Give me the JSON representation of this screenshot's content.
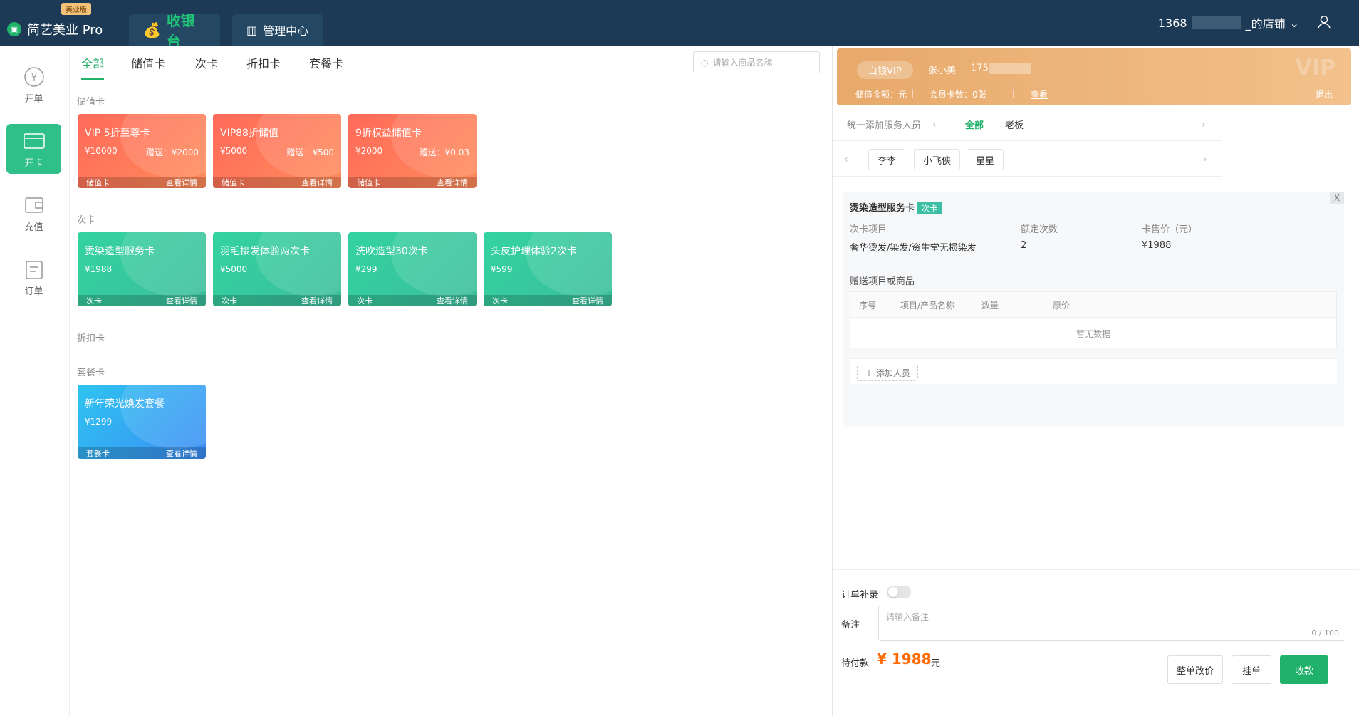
{
  "app": {
    "name": "简艺美业 Pro",
    "edition": "美业版"
  },
  "top_tabs": [
    {
      "label": "收银台"
    },
    {
      "label": "管理中心"
    }
  ],
  "store": {
    "prefix": "1368",
    "suffix": "_的店铺"
  },
  "left_nav": [
    {
      "label": "开单"
    },
    {
      "label": "开卡"
    },
    {
      "label": "充值"
    },
    {
      "label": "订单"
    }
  ],
  "product_tabs": [
    "全部",
    "储值卡",
    "次卡",
    "折扣卡",
    "套餐卡"
  ],
  "search": {
    "placeholder": "请输入商品名称"
  },
  "sections": {
    "stored": {
      "title": "储值卡",
      "cards": [
        {
          "name": "VIP 5折至尊卡",
          "price": "¥10000",
          "gift": "赠送：¥2000",
          "type": "储值卡",
          "detail": "查看详情"
        },
        {
          "name": "VIP88折储值",
          "price": "¥5000",
          "gift": "赠送：¥500",
          "type": "储值卡",
          "detail": "查看详情"
        },
        {
          "name": "9折权益储值卡",
          "price": "¥2000",
          "gift": "赠送：¥0.03",
          "type": "储值卡",
          "detail": "查看详情"
        }
      ]
    },
    "times": {
      "title": "次卡",
      "cards": [
        {
          "name": "烫染造型服务卡",
          "price": "¥1988",
          "type": "次卡",
          "detail": "查看详情"
        },
        {
          "name": "羽毛接发体验两次卡",
          "price": "¥5000",
          "type": "次卡",
          "detail": "查看详情"
        },
        {
          "name": "洗吹造型30次卡",
          "price": "¥299",
          "type": "次卡",
          "detail": "查看详情"
        },
        {
          "name": "头皮护理体验2次卡",
          "price": "¥599",
          "type": "次卡",
          "detail": "查看详情"
        }
      ]
    },
    "discount": {
      "title": "折扣卡"
    },
    "package": {
      "title": "套餐卡",
      "cards": [
        {
          "name": "新年荣光焕发套餐",
          "price": "¥1299",
          "type": "套餐卡",
          "detail": "查看详情"
        }
      ]
    }
  },
  "member": {
    "level": "白银VIP",
    "name": "张小美",
    "phone_prefix": "175",
    "balance": "储值金额：元",
    "cards": "会员卡数：0张",
    "view": "查看",
    "sep": "|",
    "logout": "退出",
    "watermark": "VIP"
  },
  "staff": {
    "label": "统一添加服务人员",
    "all": "全部",
    "boss": "老板",
    "arrow_left": "‹",
    "arrow_right": "›",
    "people": [
      "李李",
      "小飞侠",
      "星星"
    ]
  },
  "detail": {
    "title": "烫染造型服务卡",
    "tag": "次卡",
    "close": "X",
    "headers": [
      "次卡项目",
      "额定次数",
      "卡售价（元）"
    ],
    "values": [
      "奢华烫发/染发/资生堂无损染发",
      "2",
      "¥1988"
    ],
    "gift_title": "赠送项目或商品",
    "gift_headers": [
      "序号",
      "项目/产品名称",
      "数量",
      "原价"
    ],
    "empty": "暂无数据",
    "add_person": "＋ 添加人员"
  },
  "footer": {
    "supplement": "订单补录",
    "remark_label": "备注",
    "remark_placeholder": "请输入备注",
    "counter": "0 / 100",
    "pending_label": "待付款",
    "amount": "¥ 1988",
    "unit": "元",
    "buttons": [
      "整单改价",
      "挂单",
      "收款"
    ]
  },
  "colors": {
    "brand": "#20b26b",
    "topbar": "#1c3a55",
    "vip": "#e8a96a",
    "amount": "#ff6a00"
  }
}
